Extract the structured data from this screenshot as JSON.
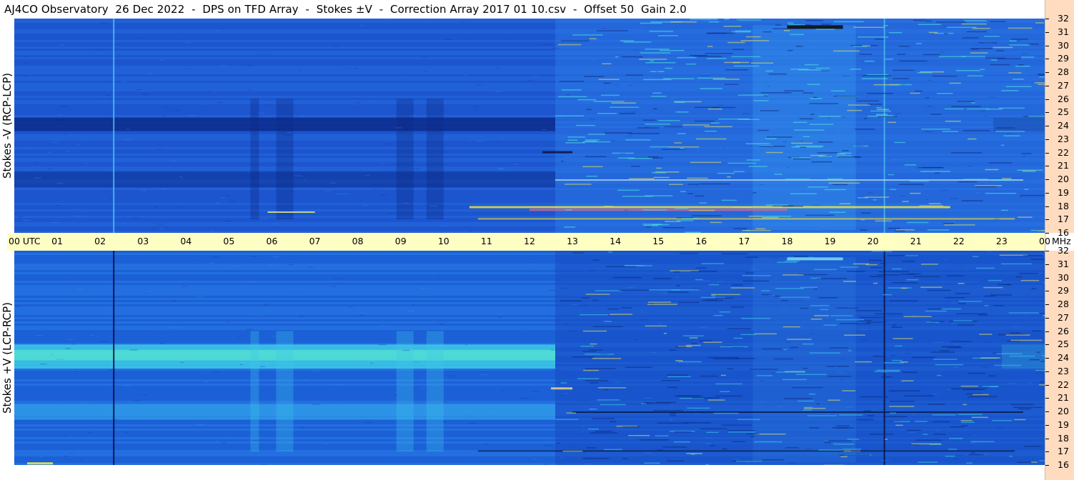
{
  "title": "AJ4CO Observatory  26 Dec 2022  -  DPS on TFD Array  -  Stokes ±V  -  Correction Array 2017 01 10.csv  -  Offset 50  Gain 2.0",
  "panels": [
    {
      "id": "top",
      "ylabel": "Stokes -V (RCP-LCP)"
    },
    {
      "id": "bottom",
      "ylabel": "Stokes +V (LCP-RCP)"
    }
  ],
  "time_axis": {
    "labels": [
      "00 UTC",
      "01",
      "02",
      "03",
      "04",
      "05",
      "06",
      "07",
      "08",
      "09",
      "10",
      "11",
      "12",
      "13",
      "14",
      "15",
      "16",
      "17",
      "18",
      "19",
      "20",
      "21",
      "22",
      "23",
      "00"
    ],
    "unit": "MHz"
  },
  "freq_axis": {
    "labels": [
      "32",
      "31",
      "30",
      "29",
      "28",
      "27",
      "26",
      "25",
      "24",
      "23",
      "22",
      "21",
      "20",
      "19",
      "18",
      "17",
      "16"
    ]
  },
  "colors": {
    "time_axis_bg": "#ffffc4",
    "freq_axis_bg": "#ffdcc0",
    "spectrum_base": "#1f5fd6",
    "spectrum_dark": "#0a2a8a",
    "spectrum_bright": "#30e0e0"
  },
  "chart_data": [
    {
      "type": "heatmap",
      "panel": "Stokes -V (RCP-LCP)",
      "x": "time (UTC hours)",
      "xlim": [
        0,
        24
      ],
      "ylim": [
        16,
        32
      ],
      "y_unit": "MHz",
      "x_ticks": [
        "00 UTC",
        "01",
        "02",
        "03",
        "04",
        "05",
        "06",
        "07",
        "08",
        "09",
        "10",
        "11",
        "12",
        "13",
        "14",
        "15",
        "16",
        "17",
        "18",
        "19",
        "20",
        "21",
        "22",
        "23",
        "00"
      ],
      "y_ticks": [
        32,
        31,
        30,
        29,
        28,
        27,
        26,
        25,
        24,
        23,
        22,
        21,
        20,
        19,
        18,
        17,
        16
      ]
    },
    {
      "type": "heatmap",
      "panel": "Stokes +V (LCP-RCP)",
      "x": "time (UTC hours)",
      "xlim": [
        0,
        24
      ],
      "ylim": [
        16,
        32
      ],
      "y_unit": "MHz",
      "x_ticks": [
        "00 UTC",
        "01",
        "02",
        "03",
        "04",
        "05",
        "06",
        "07",
        "08",
        "09",
        "10",
        "11",
        "12",
        "13",
        "14",
        "15",
        "16",
        "17",
        "18",
        "19",
        "20",
        "21",
        "22",
        "23",
        "00"
      ],
      "y_ticks": [
        32,
        31,
        30,
        29,
        28,
        27,
        26,
        25,
        24,
        23,
        22,
        21,
        20,
        19,
        18,
        17,
        16
      ]
    }
  ]
}
